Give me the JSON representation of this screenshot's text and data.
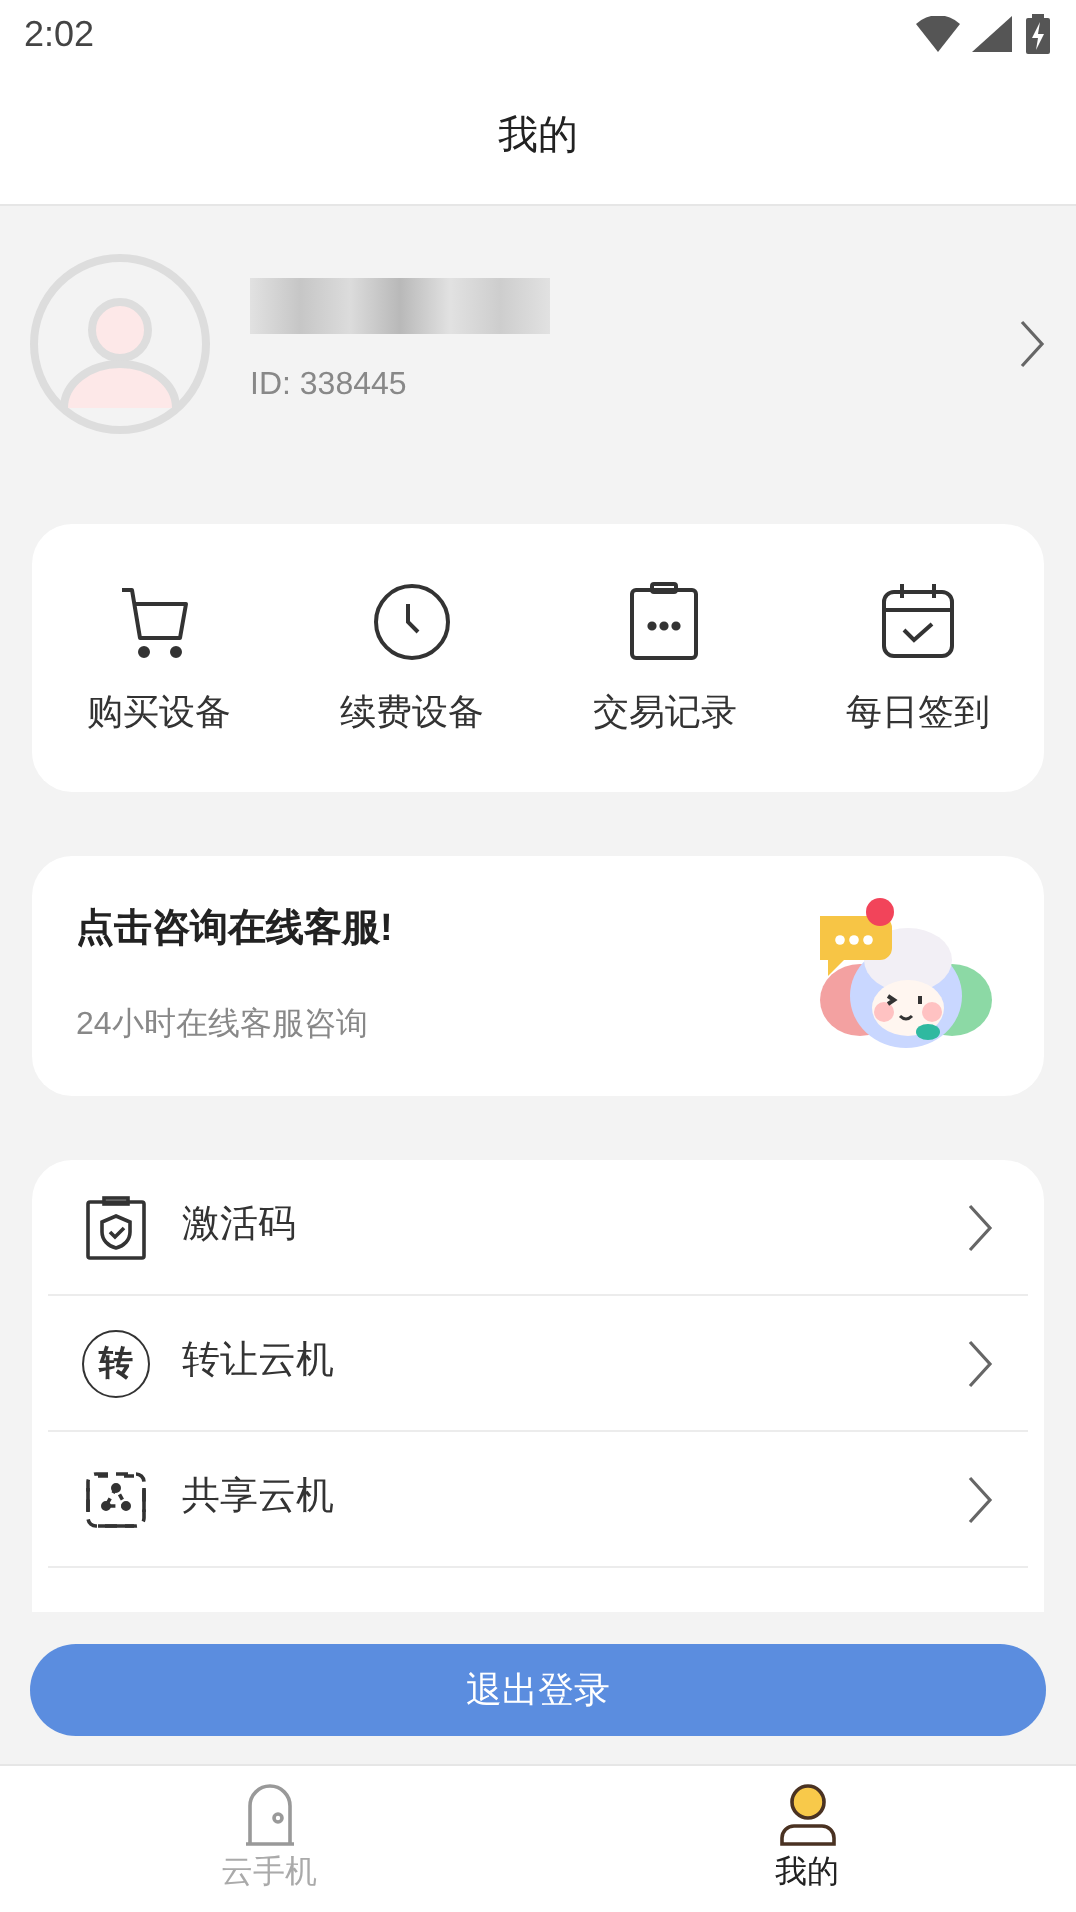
{
  "status_bar": {
    "time": "2:02"
  },
  "header": {
    "title": "我的"
  },
  "profile": {
    "user_id": "ID: 338445"
  },
  "quick_actions": [
    {
      "kind": "cart",
      "label": "购买设备"
    },
    {
      "kind": "clock",
      "label": "续费设备"
    },
    {
      "kind": "clipboard",
      "label": "交易记录"
    },
    {
      "kind": "calendar",
      "label": "每日签到"
    }
  ],
  "service_card": {
    "title": "点击咨询在线客服!",
    "subtitle": "24小时在线客服咨询"
  },
  "menu": [
    {
      "kind": "shield",
      "label": "激活码"
    },
    {
      "kind": "char",
      "icon_char": "转",
      "label": "转让云机"
    },
    {
      "kind": "share",
      "label": "共享云机"
    }
  ],
  "logout_button": "退出登录",
  "bottom_nav": [
    {
      "kind": "phone",
      "label": "云手机",
      "selected": false
    },
    {
      "kind": "person",
      "label": "我的",
      "selected": true
    }
  ]
}
